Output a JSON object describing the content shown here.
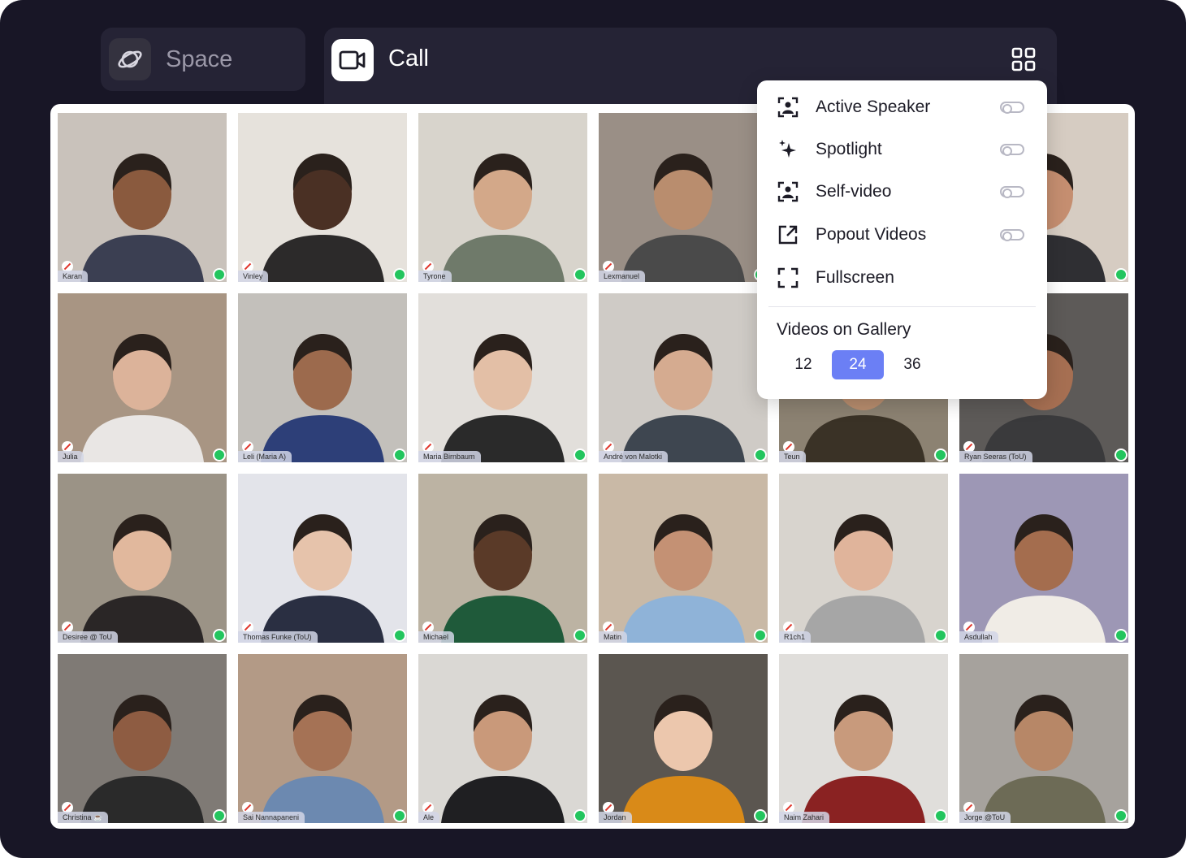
{
  "tabs": {
    "space_label": "Space",
    "call_label": "Call"
  },
  "menu": {
    "items": [
      {
        "label": "Active Speaker",
        "icon": "active-speaker-icon",
        "toggle": "off"
      },
      {
        "label": "Spotlight",
        "icon": "sparkle-icon",
        "toggle": "off"
      },
      {
        "label": "Self-video",
        "icon": "self-video-icon",
        "toggle": "off"
      },
      {
        "label": "Popout Videos",
        "icon": "popout-icon",
        "toggle": "off"
      },
      {
        "label": "Fullscreen",
        "icon": "fullscreen-icon"
      }
    ],
    "gallery_heading": "Videos on Gallery",
    "gallery_options": [
      "12",
      "24",
      "36"
    ],
    "gallery_selected": "24"
  },
  "participants": [
    "Karan",
    "Vinley",
    "Tyrone",
    "Lexmanuel",
    "",
    "",
    "Julia",
    "Leli (Maria A)",
    "Maria Birnbaum",
    "André von Malotki",
    "Teun",
    "Ryan Seeras (ToU)",
    "Desiree @ ToU",
    "Thomas Funke (ToU)",
    "Michael",
    "Matin",
    "R1ch1",
    "Asdullah",
    "Christina ☕",
    "Sai Nannapaneni",
    "Ale",
    "Jordan",
    "Naim Zahari",
    "Jorge @ToU"
  ],
  "colors": {
    "frame_bg": "#181626",
    "tab_bg": "#252335",
    "accent": "#6b7ff5",
    "online": "#23c55e",
    "muted": "#e0352b"
  }
}
